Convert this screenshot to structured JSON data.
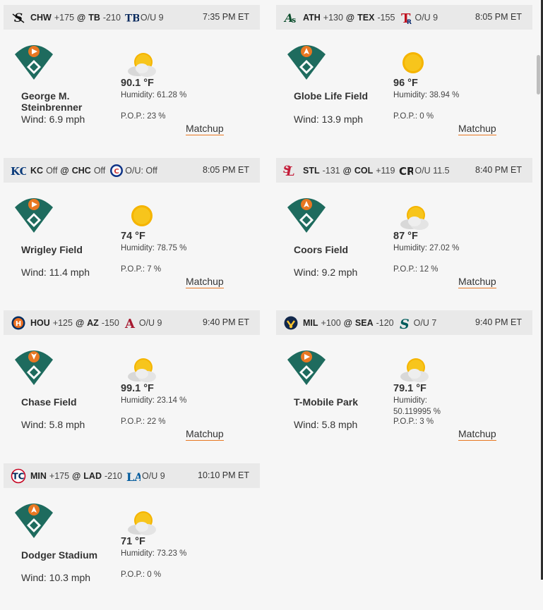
{
  "colors": {
    "accent": "#e87722",
    "field": "#1e6b5e",
    "header_bg": "#e9e9e9",
    "page_bg": "#f6f6f6"
  },
  "common": {
    "matchup_label": "Matchup"
  },
  "games": [
    {
      "away": "CHW",
      "away_ml": "+175",
      "away_icon": "white-sox-logo-icon",
      "at": "@",
      "home": "TB",
      "home_ml": "-210",
      "home_icon": "rays-logo-icon",
      "ou": "O/U 9",
      "time": "7:35 PM ET",
      "venue": "George M. Steinbrenner",
      "wind": "Wind: 6.9 mph",
      "temp": "90.1 °F",
      "humidity": "Humidity: 61.28 %",
      "pop": "P.O.P.: 23 %",
      "weather_icon": "partly-cloudy-icon"
    },
    {
      "away": "ATH",
      "away_ml": "+130",
      "away_icon": "athletics-logo-icon",
      "at": "@",
      "home": "TEX",
      "home_ml": "-155",
      "home_icon": "rangers-logo-icon",
      "ou": "O/U 9",
      "time": "8:05 PM ET",
      "venue": "Globe Life Field",
      "wind": "Wind: 13.9 mph",
      "temp": "96 °F",
      "humidity": "Humidity: 38.94 %",
      "pop": "P.O.P.: 0 %",
      "weather_icon": "sunny-icon"
    },
    {
      "away": "KC",
      "away_ml": "Off",
      "away_icon": "royals-logo-icon",
      "at": "@",
      "home": "CHC",
      "home_ml": "Off",
      "home_icon": "cubs-logo-icon",
      "ou": "O/U: Off",
      "time": "8:05 PM ET",
      "venue": "Wrigley Field",
      "wind": "Wind: 11.4 mph",
      "temp": "74 °F",
      "humidity": "Humidity: 78.75 %",
      "pop": "P.O.P.: 7 %",
      "weather_icon": "sunny-icon"
    },
    {
      "away": "STL",
      "away_ml": "-131",
      "away_icon": "cardinals-logo-icon",
      "at": "@",
      "home": "COL",
      "home_ml": "+119",
      "home_icon": "rockies-logo-icon",
      "ou": "O/U 11.5",
      "time": "8:40 PM ET",
      "venue": "Coors Field",
      "wind": "Wind: 9.2 mph",
      "temp": "87 °F",
      "humidity": "Humidity: 27.02 %",
      "pop": "P.O.P.: 12 %",
      "weather_icon": "partly-cloudy-icon"
    },
    {
      "away": "HOU",
      "away_ml": "+125",
      "away_icon": "astros-logo-icon",
      "at": "@",
      "home": "AZ",
      "home_ml": "-150",
      "home_icon": "diamondbacks-logo-icon",
      "ou": "O/U 9",
      "time": "9:40 PM ET",
      "venue": "Chase Field",
      "wind": "Wind: 5.8 mph",
      "temp": "99.1 °F",
      "humidity": "Humidity: 23.14 %",
      "pop": "P.O.P.: 22 %",
      "weather_icon": "partly-cloudy-icon"
    },
    {
      "away": "MIL",
      "away_ml": "+100",
      "away_icon": "brewers-logo-icon",
      "at": "@",
      "home": "SEA",
      "home_ml": "-120",
      "home_icon": "mariners-logo-icon",
      "ou": "O/U 7",
      "time": "9:40 PM ET",
      "venue": "T-Mobile Park",
      "wind": "Wind: 5.8 mph",
      "temp": "79.1 °F",
      "humidity": "Humidity: 50.119995 %",
      "pop": "P.O.P.: 3 %",
      "weather_icon": "partly-cloudy-icon"
    },
    {
      "away": "MIN",
      "away_ml": "+175",
      "away_icon": "twins-logo-icon",
      "at": "@",
      "home": "LAD",
      "home_ml": "-210",
      "home_icon": "dodgers-logo-icon",
      "ou": "O/U 9",
      "time": "10:10 PM ET",
      "venue": "Dodger Stadium",
      "wind": "Wind: 10.3 mph",
      "temp": "71 °F",
      "humidity": "Humidity: 73.23 %",
      "pop": "P.O.P.: 0 %",
      "weather_icon": "partly-cloudy-icon"
    }
  ]
}
